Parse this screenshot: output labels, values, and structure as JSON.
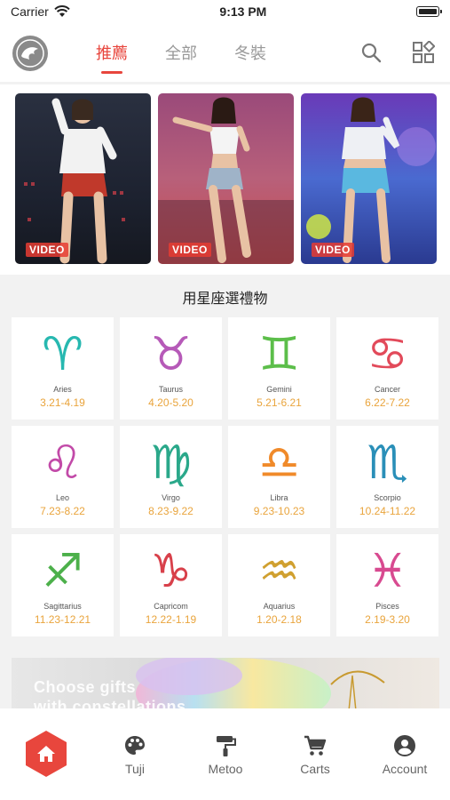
{
  "status": {
    "carrier": "Carrier",
    "time": "9:13 PM"
  },
  "header": {
    "tabs": [
      {
        "label": "推薦",
        "active": true
      },
      {
        "label": "全部",
        "active": false
      },
      {
        "label": "冬裝",
        "active": false
      }
    ]
  },
  "videos": [
    {
      "badge": "VIDEO"
    },
    {
      "badge": "VIDEO"
    },
    {
      "badge": "VIDEO"
    }
  ],
  "zodiac": {
    "title": "用星座選禮物",
    "signs": [
      {
        "symbol": "♈",
        "name": "Aries",
        "dates": "3.21-4.19",
        "color": "#27b8b0"
      },
      {
        "symbol": "♉",
        "name": "Taurus",
        "dates": "4.20-5.20",
        "color": "#b65ab8"
      },
      {
        "symbol": "♊",
        "name": "Gemini",
        "dates": "5.21-6.21",
        "color": "#5cbe4a"
      },
      {
        "symbol": "♋",
        "name": "Cancer",
        "dates": "6.22-7.22",
        "color": "#e24a5a"
      },
      {
        "symbol": "♌",
        "name": "Leo",
        "dates": "7.23-8.22",
        "color": "#c24aa8"
      },
      {
        "symbol": "♍",
        "name": "Virgo",
        "dates": "8.23-9.22",
        "color": "#2aa88a"
      },
      {
        "symbol": "♎",
        "name": "Libra",
        "dates": "9.23-10.23",
        "color": "#f08a2a"
      },
      {
        "symbol": "♏",
        "name": "Scorpio",
        "dates": "10.24-11.22",
        "color": "#2a8fb8"
      },
      {
        "symbol": "♐",
        "name": "Sagittarius",
        "dates": "11.23-12.21",
        "color": "#4cb04a"
      },
      {
        "symbol": "♑",
        "name": "Capricom",
        "dates": "12.22-1.19",
        "color": "#d8404a"
      },
      {
        "symbol": "♒",
        "name": "Aquarius",
        "dates": "1.20-2.18",
        "color": "#d0a030"
      },
      {
        "symbol": "♓",
        "name": "Pisces",
        "dates": "2.19-3.20",
        "color": "#d84a90"
      }
    ]
  },
  "banner": {
    "line1": "Choose gifts",
    "line2": "with constellations"
  },
  "bottom_nav": {
    "accent": "#e8463d",
    "items": [
      {
        "label": "Tuji",
        "icon": "palette-icon"
      },
      {
        "label": "Metoo",
        "icon": "paint-roller-icon"
      },
      {
        "label": "Carts",
        "icon": "cart-icon"
      },
      {
        "label": "Account",
        "icon": "account-icon"
      }
    ]
  }
}
